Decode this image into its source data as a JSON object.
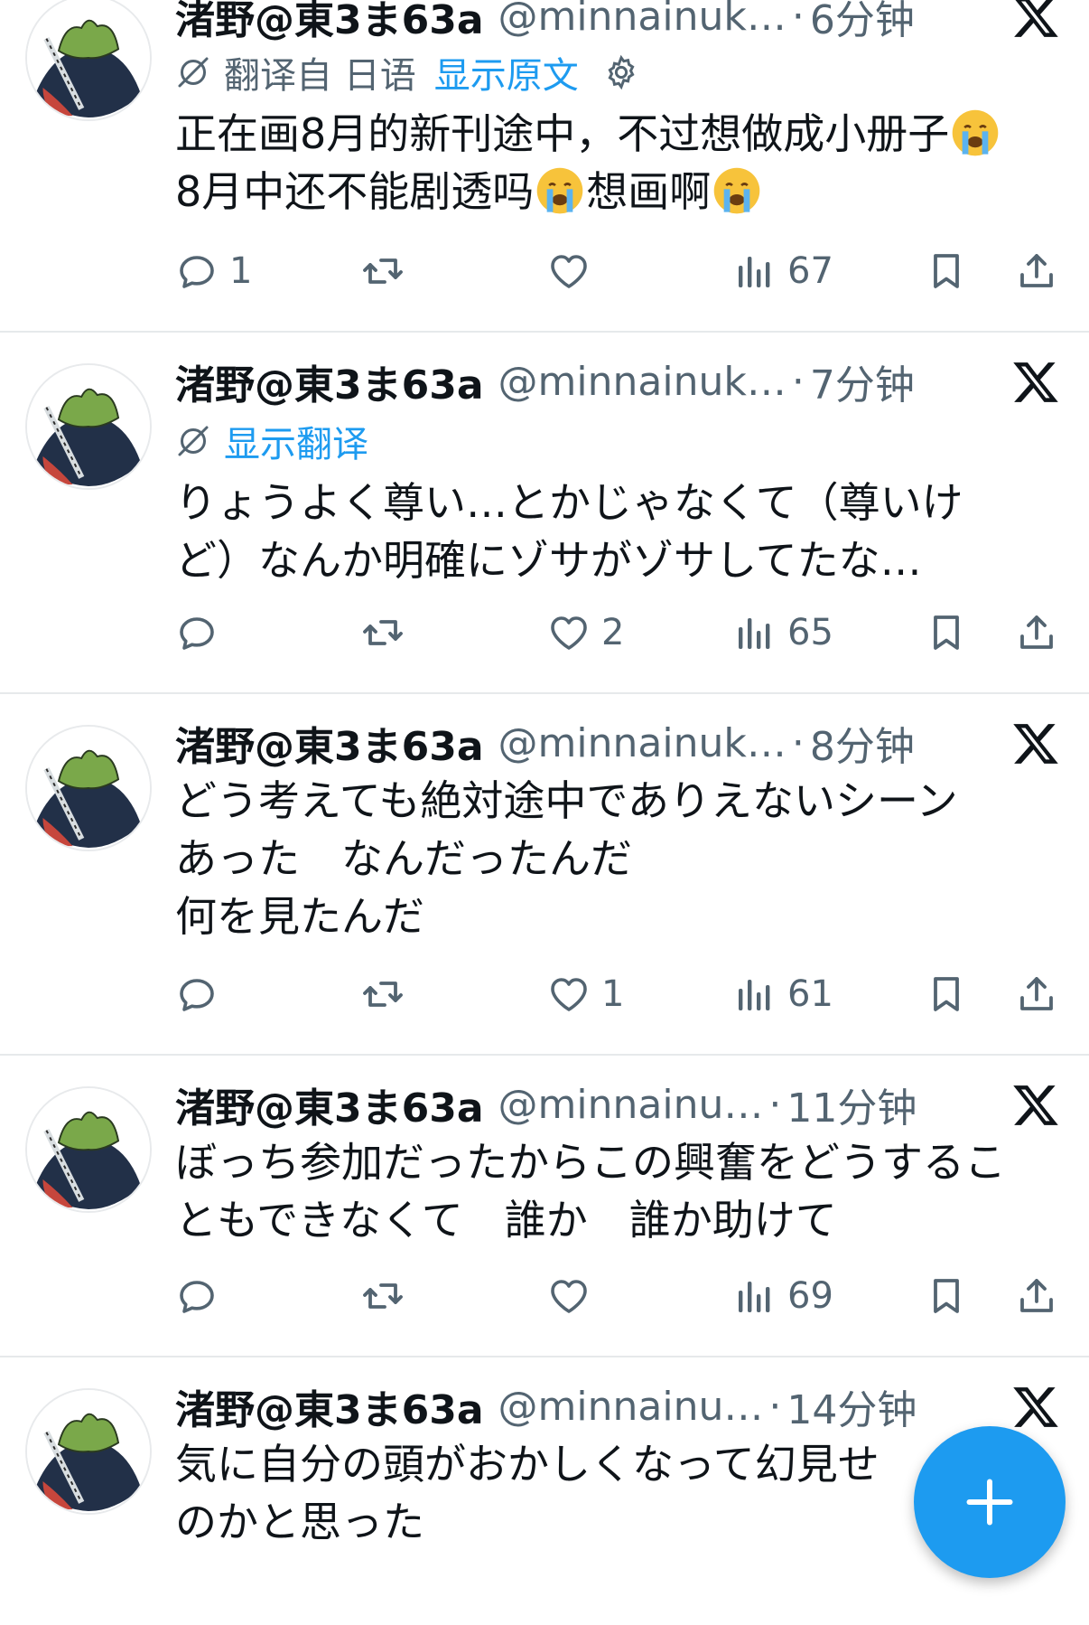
{
  "account": {
    "name": "渚野@東3ま63a"
  },
  "tweets": [
    {
      "handle": "@minnainuk…",
      "time": "6分钟",
      "translation": {
        "from": "翻译自 日语",
        "link": "显示原文"
      },
      "lines": [
        "正在画8月的新刊途中，不过想做成小册子",
        "8月中还不能剧透吗",
        "想画啊"
      ],
      "stats": {
        "replies": "1",
        "retweets": "",
        "likes": "",
        "views": "67"
      }
    },
    {
      "handle": "@minnainuk…",
      "time": "7分钟",
      "translation": {
        "link": "显示翻译"
      },
      "lines": [
        "りょうよく尊い…とかじゃなくて（尊いけ",
        "ど）なんか明確にゾサがゾサしてたな…"
      ],
      "stats": {
        "replies": "",
        "retweets": "",
        "likes": "2",
        "views": "65"
      }
    },
    {
      "handle": "@minnainuk…",
      "time": "8分钟",
      "lines": [
        "どう考えても絶対途中でありえないシーン",
        "あった　なんだったんだ",
        "何を見たんだ"
      ],
      "stats": {
        "replies": "",
        "retweets": "",
        "likes": "1",
        "views": "61"
      }
    },
    {
      "handle": "@minnainu…",
      "time": "11分钟",
      "lines": [
        "ぼっち参加だったからこの興奮をどうするこ",
        "ともできなくて　誰か　誰か助けて"
      ],
      "stats": {
        "replies": "",
        "retweets": "",
        "likes": "",
        "views": "69"
      }
    },
    {
      "handle": "@minnainu…",
      "time": "14分钟",
      "lines": [
        "気に自分の頭がおかしくなって幻見せ",
        "のかと思った"
      ]
    }
  ],
  "colors": {
    "accent": "#1d9bf0",
    "secondary_text": "#536471",
    "divider": "#e6e9eb"
  },
  "icons": [
    "x-logo-icon",
    "translate-icon",
    "gear-icon",
    "reply-icon",
    "retweet-icon",
    "like-icon",
    "views-icon",
    "bookmark-icon",
    "share-icon",
    "crying-emoji-icon",
    "plus-icon"
  ]
}
